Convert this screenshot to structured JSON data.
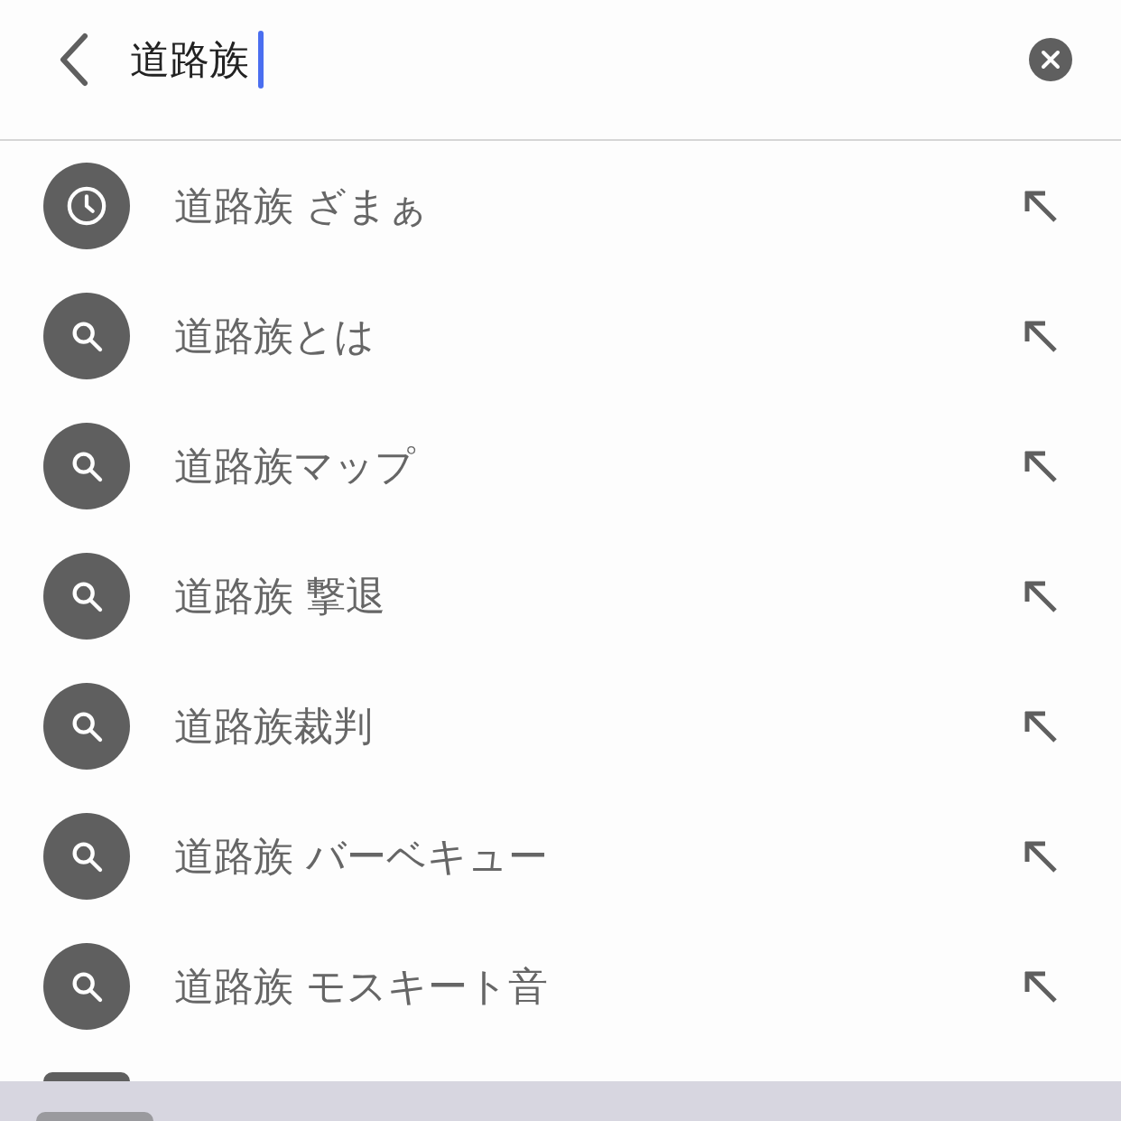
{
  "search": {
    "value": "道路族"
  },
  "suggestions": [
    {
      "kind": "history",
      "text": "道路族 ざまぁ"
    },
    {
      "kind": "search",
      "text": "道路族とは"
    },
    {
      "kind": "search",
      "text": "道路族マップ"
    },
    {
      "kind": "search",
      "text": "道路族 撃退"
    },
    {
      "kind": "search",
      "text": "道路族裁判"
    },
    {
      "kind": "search",
      "text": "道路族 バーベキュー"
    },
    {
      "kind": "search",
      "text": "道路族 モスキート音"
    }
  ]
}
